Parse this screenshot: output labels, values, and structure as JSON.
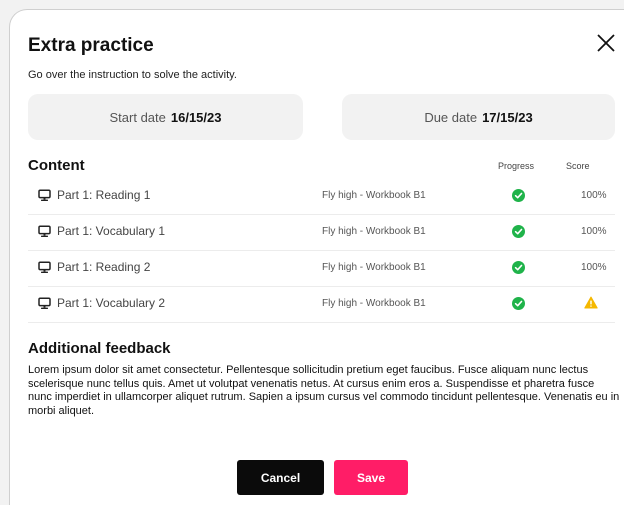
{
  "modal": {
    "title": "Extra practice",
    "subtitle": "Go over the instruction to solve the activity."
  },
  "dates": {
    "start_label": "Start date",
    "start_value": "16/15/23",
    "due_label": "Due date",
    "due_value": "17/15/23"
  },
  "content": {
    "heading": "Content",
    "columns": {
      "progress": "Progress",
      "score": "Score"
    },
    "rows": [
      {
        "name": "Part 1: Reading 1",
        "book": "Fly high - Workbook B1",
        "progress": "complete",
        "score": "100%"
      },
      {
        "name": "Part 1: Vocabulary 1",
        "book": "Fly high - Workbook B1",
        "progress": "complete",
        "score": "100%"
      },
      {
        "name": "Part 1: Reading 2",
        "book": "Fly high - Workbook B1",
        "progress": "complete",
        "score": "100%"
      },
      {
        "name": "Part 1: Vocabulary 2",
        "book": "Fly high - Workbook B1",
        "progress": "complete",
        "score": "warning"
      }
    ]
  },
  "feedback": {
    "heading": "Additional feedback",
    "text": "Lorem ipsum dolor sit amet consectetur. Pellentesque sollicitudin pretium eget faucibus. Fusce aliquam nunc lectus scelerisque nunc tellus quis. Amet ut volutpat venenatis netus. At cursus enim eros a. Suspendisse et pharetra fusce nunc imperdiet in ullamcorper aliquet rutrum. Sapien a ipsum cursus vel commodo tincidunt pellentesque. Venenatis eu in morbi aliquet."
  },
  "buttons": {
    "cancel": "Cancel",
    "save": "Save"
  },
  "colors": {
    "accent": "#ff1d67",
    "success": "#1fb34a",
    "warning": "#f5b800",
    "primary_button": "#0b0b0b"
  },
  "icons": {
    "close": "close-icon",
    "row": "monitor-icon",
    "progress": "check-circle-icon",
    "score_warning": "warning-triangle-icon"
  }
}
